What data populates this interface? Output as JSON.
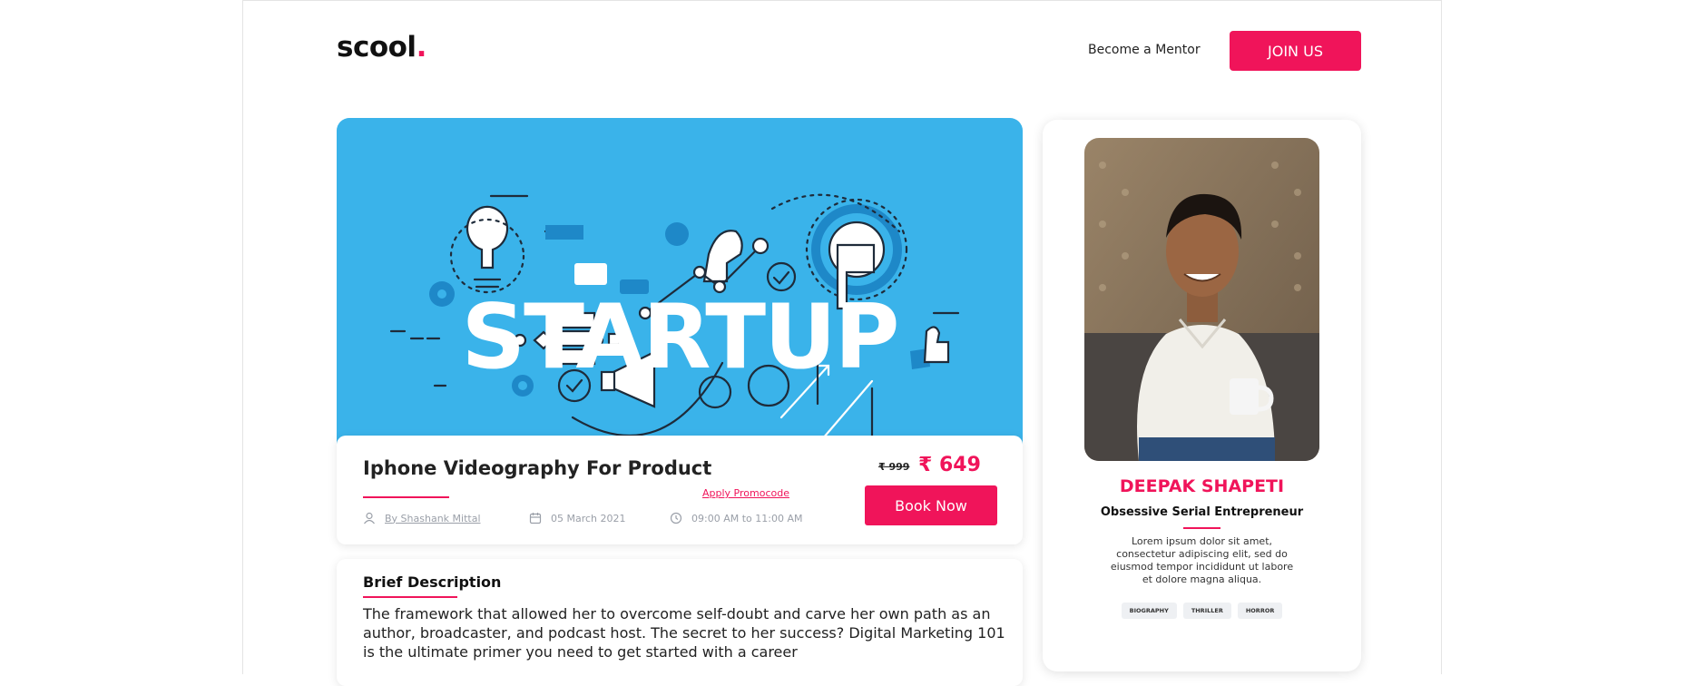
{
  "header": {
    "logo_text": "scool",
    "logo_dot": ".",
    "nav_link": "Become a Mentor",
    "join_button": "JOIN US"
  },
  "banner": {
    "word": "STARTUP"
  },
  "course": {
    "title": "Iphone Videography For Product",
    "author": "By Shashank Mittal",
    "date": "05 March 2021",
    "time": "09:00 AM to 11:00 AM",
    "promo_link": "Apply Promocode",
    "old_price": "₹ 999",
    "new_price": "₹ 649",
    "book_button": "Book Now"
  },
  "description": {
    "title": "Brief Description",
    "text": "The framework that allowed her to overcome self-doubt and carve her own path as an author, broadcaster, and podcast host. The secret to her success? Digital Marketing 101 is the ultimate primer you need to get started with a career"
  },
  "mentor": {
    "name": "DEEPAK SHAPETI",
    "role": "Obsessive Serial Entrepreneur",
    "bio": "Lorem ipsum dolor sit amet, consectetur adipiscing elit, sed do eiusmod tempor incididunt ut labore et dolore magna aliqua.",
    "tags": [
      "BIOGRAPHY",
      "THRILLER",
      "HORROR"
    ]
  },
  "colors": {
    "accent": "#f0145a",
    "banner_bg": "#3ab3ea"
  }
}
